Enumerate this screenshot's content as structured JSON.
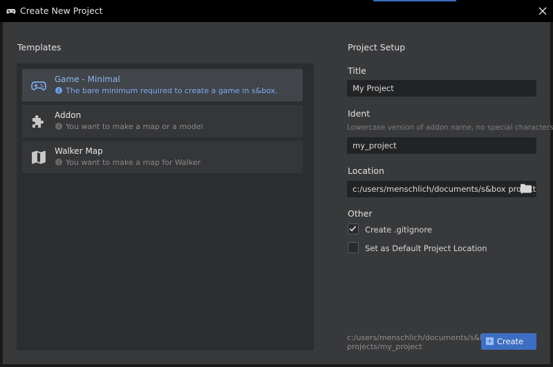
{
  "window": {
    "title": "Create New Project"
  },
  "templates": {
    "heading": "Templates",
    "items": [
      {
        "name": "Game - Minimal",
        "description": "The bare minimum required to create a game in s&box.",
        "icon": "gamepad-icon",
        "selected": true
      },
      {
        "name": "Addon",
        "description": "You want to make a map or a model",
        "icon": "puzzle-icon",
        "selected": false
      },
      {
        "name": "Walker Map",
        "description": "You want to make a map for Walker",
        "icon": "map-icon",
        "selected": false
      }
    ]
  },
  "setup": {
    "heading": "Project Setup",
    "title_label": "Title",
    "title_value": "My Project",
    "ident_label": "Ident",
    "ident_hint": "Lowercase version of addon name, no special characters",
    "ident_value": "my_project",
    "location_label": "Location",
    "location_value": "c:/users/menschlich/documents/s&box projects",
    "other_label": "Other",
    "options": [
      {
        "label": "Create .gitignore",
        "checked": true
      },
      {
        "label": "Set as Default Project Location",
        "checked": false
      }
    ]
  },
  "footer": {
    "path_line1": "c:/users/menschlich/documents/s&box",
    "path_line2": "projects/my_project",
    "create_label": "Create"
  },
  "colors": {
    "accent": "#3c6fc4",
    "selected_text": "#8fb4f0"
  }
}
